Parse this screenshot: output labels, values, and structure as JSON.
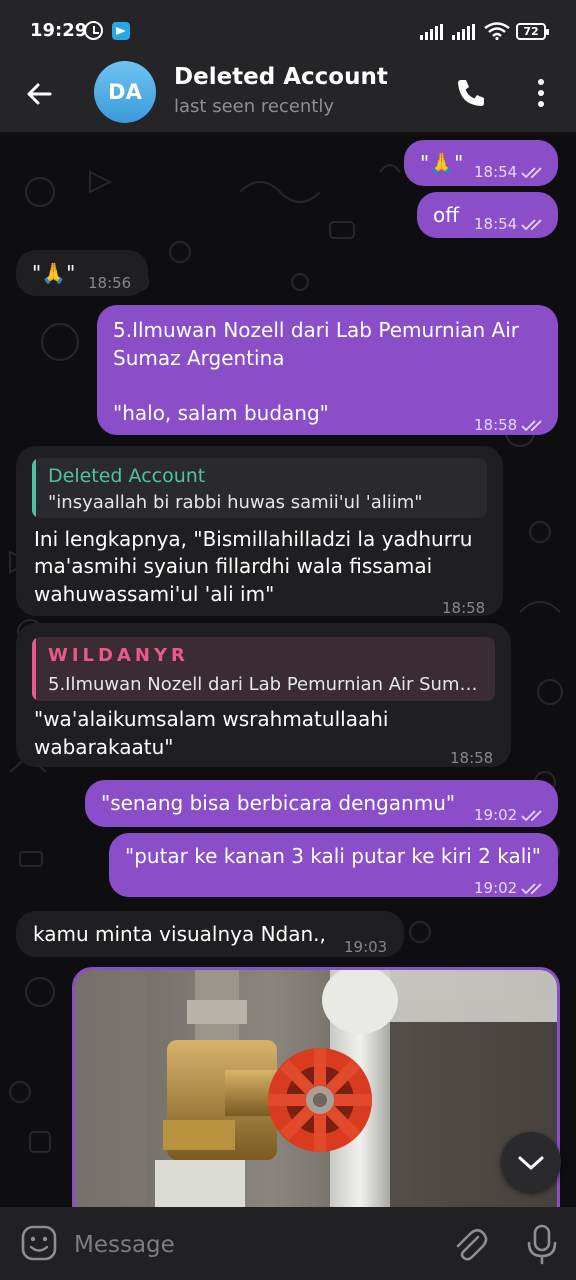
{
  "status_bar": {
    "time": "19:29",
    "battery": "72",
    "icons": [
      "alarm-icon",
      "telegram-icon",
      "signal-icon",
      "signal-icon",
      "wifi-icon",
      "battery-icon"
    ]
  },
  "header": {
    "avatar_initials": "DA",
    "avatar_color": "#4aa9e6",
    "title": "Deleted Account",
    "subtitle": "last seen recently",
    "icons": [
      "back-arrow-icon",
      "phone-icon",
      "more-vertical-icon"
    ]
  },
  "messages": [
    {
      "dir": "out",
      "text": "\"🙏\"",
      "time": "18:54",
      "read": true
    },
    {
      "dir": "out",
      "text": "off",
      "time": "18:54",
      "read": true
    },
    {
      "dir": "in",
      "text": "\"🙏\"",
      "time": "18:56"
    },
    {
      "dir": "out",
      "line1": "5.Ilmuwan Nozell dari Lab Pemurnian Air",
      "line2": "Sumaz Argentina",
      "line3": "\"halo, salam budang\"",
      "time": "18:58",
      "read": true
    },
    {
      "dir": "in",
      "reply": {
        "name": "Deleted Account",
        "text": "\"insyaallah bi rabbi huwas samii'ul 'aliim\"",
        "color": "#4fc3a1"
      },
      "line1": "Ini lengkapnya, \"Bismillahilladzi la yadhurru",
      "line2": "ma'asmihi syaiun fillardhi wala fissamai",
      "line3": "wahuwassami'ul 'ali im\"",
      "time": "18:58"
    },
    {
      "dir": "in",
      "reply": {
        "name": "WILDANYR",
        "text": "5.Ilmuwan Nozell dari Lab Pemurnian Air Sum…",
        "color": "#e85a8a"
      },
      "line1": "\"wa'alaikumsalam wsrahmatullaahi",
      "line2": "wabarakaatu\"",
      "time": "18:58"
    },
    {
      "dir": "out",
      "text": "\"senang bisa berbicara denganmu\"",
      "time": "19:02",
      "read": true
    },
    {
      "dir": "out",
      "text": "\"putar ke kanan 3 kali putar ke kiri 2 kali\"",
      "time": "19:02",
      "read": true
    },
    {
      "dir": "in",
      "text": "kamu minta visualnya Ndan.,",
      "time": "19:03"
    }
  ],
  "photo": {
    "type": "image",
    "subject": "red valve on pipe",
    "accent": "#d93b1f"
  },
  "colors": {
    "outgoing_bubble": "#8a4fc8",
    "incoming_bubble": "#1f1f22",
    "background": "#0e0e10"
  },
  "input": {
    "placeholder": "Message",
    "icons": [
      "emoji-icon",
      "attach-icon",
      "microphone-icon"
    ]
  },
  "scroll_down_icon": "chevron-down-icon"
}
